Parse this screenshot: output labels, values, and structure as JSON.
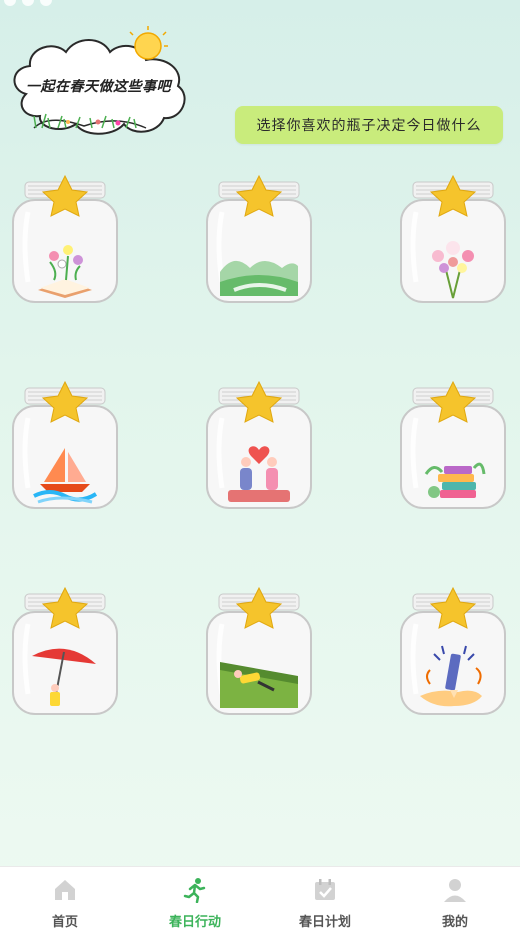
{
  "header": {
    "cloud_title": "一起在春天做这些事吧",
    "prompt": "选择你喜欢的瓶子决定今日做什么"
  },
  "jars": [
    {
      "icon": "book-flowers-icon"
    },
    {
      "icon": "green-hills-icon"
    },
    {
      "icon": "flower-bouquet-icon"
    },
    {
      "icon": "sailboat-icon"
    },
    {
      "icon": "couple-heart-icon"
    },
    {
      "icon": "books-plant-icon"
    },
    {
      "icon": "red-umbrella-icon"
    },
    {
      "icon": "lying-on-grass-icon"
    },
    {
      "icon": "pencil-hand-icon"
    }
  ],
  "tabbar": {
    "items": [
      {
        "label": "首页",
        "icon": "home-icon",
        "active": false
      },
      {
        "label": "春日行动",
        "icon": "running-icon",
        "active": true
      },
      {
        "label": "春日计划",
        "icon": "calendar-icon",
        "active": false
      },
      {
        "label": "我的",
        "icon": "user-icon",
        "active": false
      }
    ]
  },
  "colors": {
    "accent": "#3cb35a",
    "pill": "#c9ec7c",
    "star": "#f5c42c"
  }
}
